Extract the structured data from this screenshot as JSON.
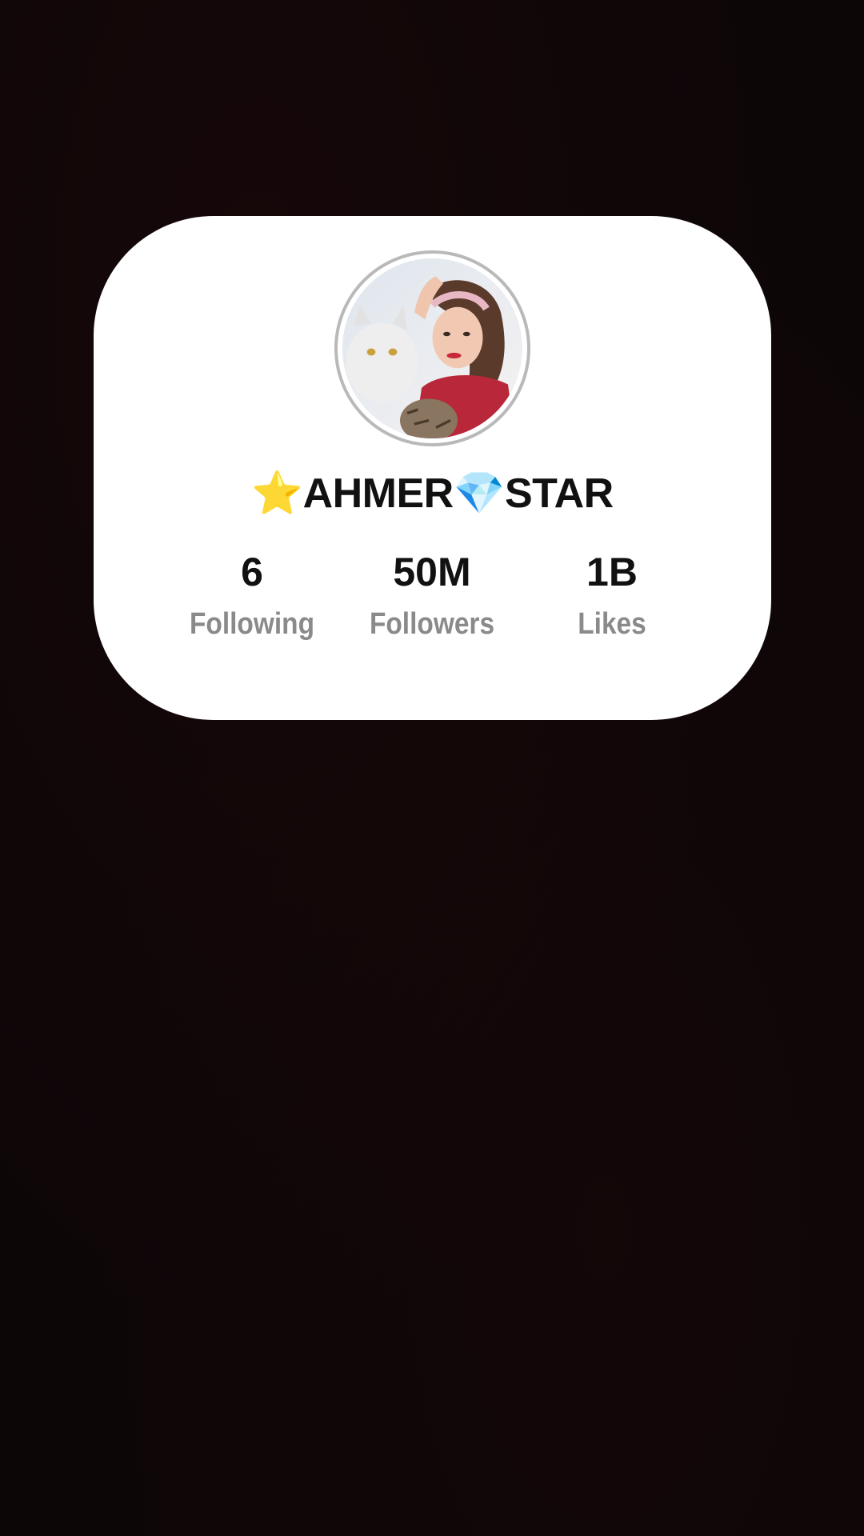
{
  "profile": {
    "username": "⭐AHMER💎STAR",
    "avatar_icon": "profile-photo-avatar"
  },
  "stats": {
    "following": {
      "value": "6",
      "label": "Following"
    },
    "followers": {
      "value": "50M",
      "label": "Followers"
    },
    "likes": {
      "value": "1B",
      "label": "Likes"
    }
  },
  "colors": {
    "background": "#0d0607",
    "card": "#ffffff",
    "value_text": "#111111",
    "label_text": "#8a8a8a",
    "avatar_ring": "#b9b9b9"
  }
}
